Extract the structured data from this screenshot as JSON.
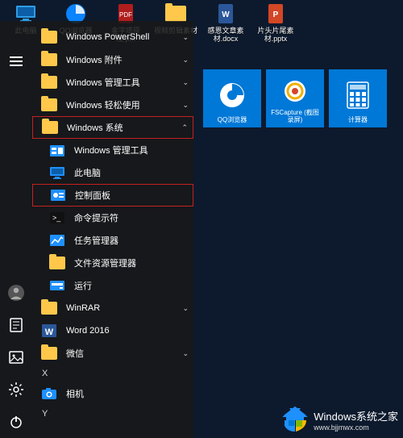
{
  "desktop": [
    {
      "label": "此电脑"
    },
    {
      "label": "QQ浏览器"
    },
    {
      "label": "金字塔原理.pdf"
    },
    {
      "label": "视频剪辑素材"
    },
    {
      "label": "感恩文章素材.docx"
    },
    {
      "label": "片头片尾素材.pptx"
    }
  ],
  "menu": {
    "items": [
      {
        "label": "Windows PowerShell",
        "kind": "folder",
        "chev": "down"
      },
      {
        "label": "Windows 附件",
        "kind": "folder",
        "chev": "down"
      },
      {
        "label": "Windows 管理工具",
        "kind": "folder",
        "chev": "down"
      },
      {
        "label": "Windows 轻松使用",
        "kind": "folder",
        "chev": "down"
      },
      {
        "label": "Windows 系统",
        "kind": "folder",
        "chev": "up",
        "hl": "outer"
      },
      {
        "label": "Windows 管理工具",
        "kind": "admin",
        "sub": true
      },
      {
        "label": "此电脑",
        "kind": "pc",
        "sub": true
      },
      {
        "label": "控制面板",
        "kind": "cpl",
        "sub": true,
        "hl": "inner"
      },
      {
        "label": "命令提示符",
        "kind": "cmd",
        "sub": true
      },
      {
        "label": "任务管理器",
        "kind": "task",
        "sub": true
      },
      {
        "label": "文件资源管理器",
        "kind": "explorer",
        "sub": true
      },
      {
        "label": "运行",
        "kind": "run",
        "sub": true
      },
      {
        "label": "WinRAR",
        "kind": "folder",
        "chev": "down"
      },
      {
        "label": "Word 2016",
        "kind": "word"
      },
      {
        "label": "微信",
        "kind": "folder",
        "chev": "down"
      }
    ],
    "letter_x": "X",
    "camera": "相机",
    "letter_y": "Y"
  },
  "tiles": [
    {
      "label": "QQ浏览器"
    },
    {
      "label": "FSCapture (截图录屏)"
    },
    {
      "label": "计算器"
    }
  ],
  "watermark": {
    "a": "Windows系统之家",
    "b": "www.bjjmwx.com"
  }
}
